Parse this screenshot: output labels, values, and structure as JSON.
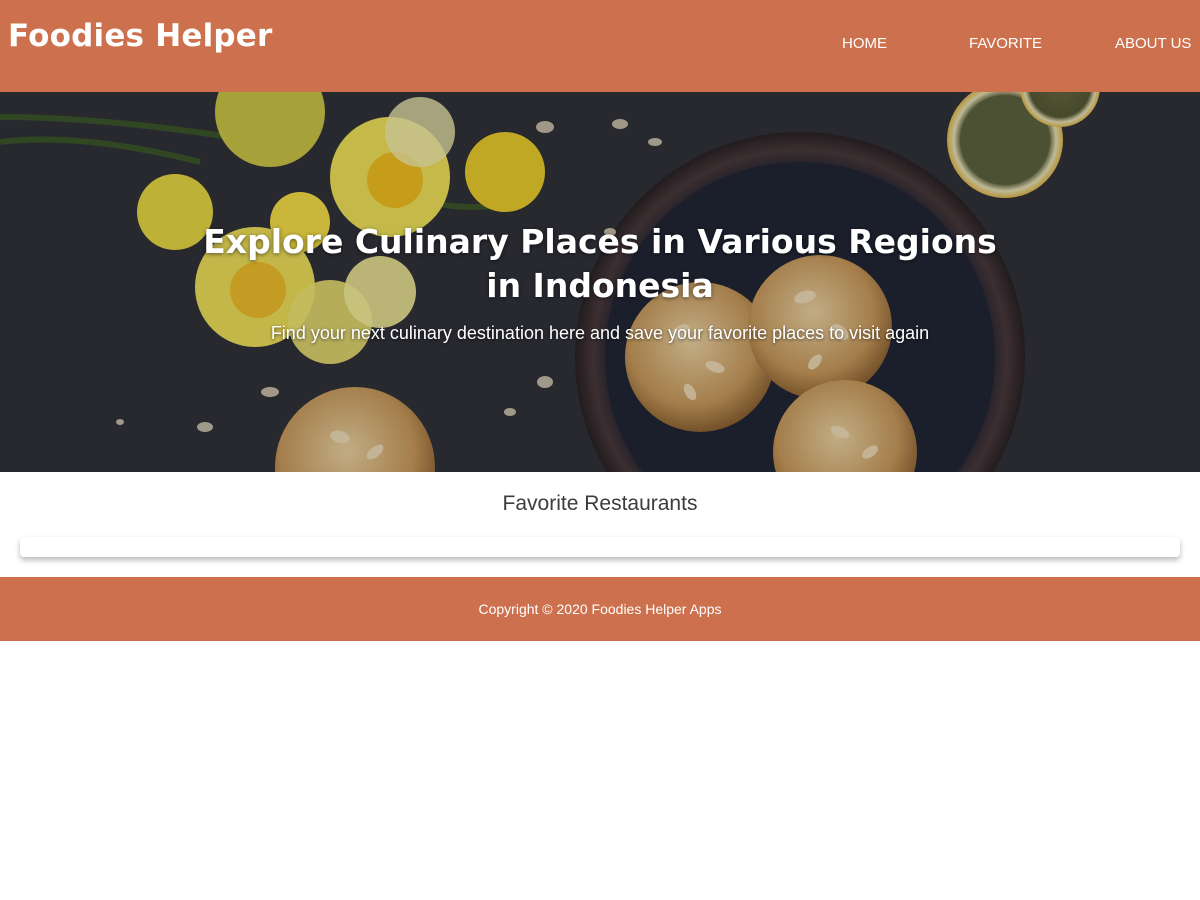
{
  "header": {
    "brand": "Foodies Helper",
    "nav": [
      {
        "label": "HOME"
      },
      {
        "label": "FAVORITE"
      },
      {
        "label": "ABOUT US"
      }
    ]
  },
  "hero": {
    "title": "Explore Culinary Places in Various Regions in Indonesia",
    "tagline": "Find your next culinary destination here and save your favorite places to visit again"
  },
  "main": {
    "section_title": "Favorite Restaurants",
    "restaurants": []
  },
  "footer": {
    "copyright": "Copyright © 2020 Foodies Helper Apps"
  },
  "colors": {
    "primary": "#cd704d",
    "hero_background": "#2b2c33",
    "heading_text": "#3c3c3c"
  }
}
